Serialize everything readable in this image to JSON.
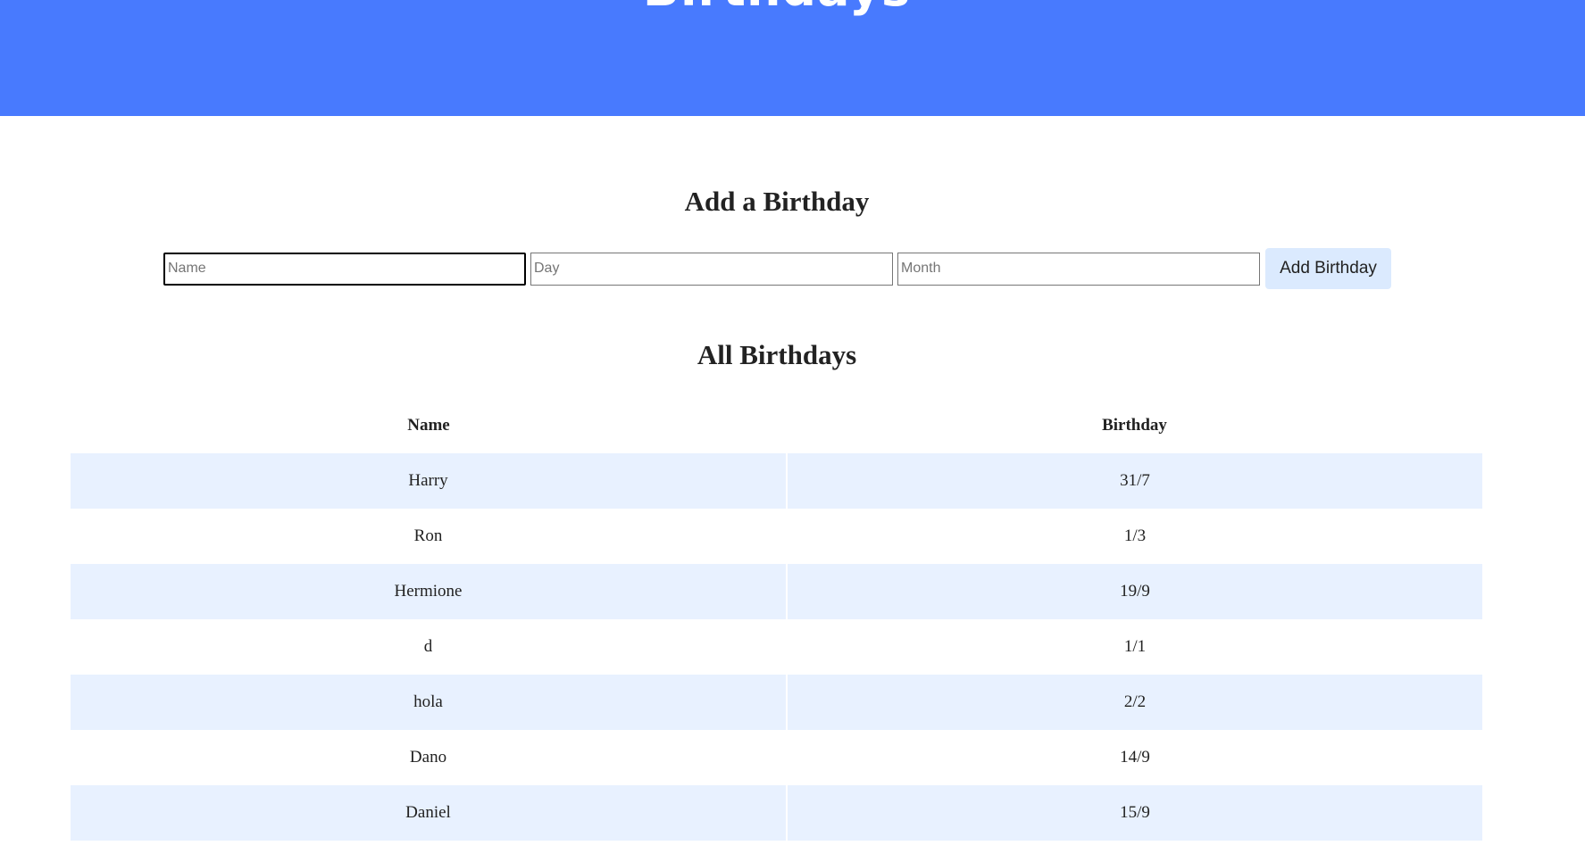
{
  "header": {
    "title": "Birthdays"
  },
  "add_section": {
    "title": "Add a Birthday",
    "name_placeholder": "Name",
    "day_placeholder": "Day",
    "month_placeholder": "Month",
    "button_label": "Add Birthday"
  },
  "list_section": {
    "title": "All Birthdays",
    "columns": [
      "Name",
      "Birthday"
    ],
    "rows": [
      {
        "name": "Harry",
        "birthday": "31/7"
      },
      {
        "name": "Ron",
        "birthday": "1/3"
      },
      {
        "name": "Hermione",
        "birthday": "19/9"
      },
      {
        "name": "d",
        "birthday": "1/1"
      },
      {
        "name": "hola",
        "birthday": "2/2"
      },
      {
        "name": "Dano",
        "birthday": "14/9"
      },
      {
        "name": "Daniel",
        "birthday": "15/9"
      }
    ]
  },
  "colors": {
    "header_bg": "#487afe",
    "button_bg": "#dbeafe",
    "row_alt_bg": "#e8f1ff"
  }
}
